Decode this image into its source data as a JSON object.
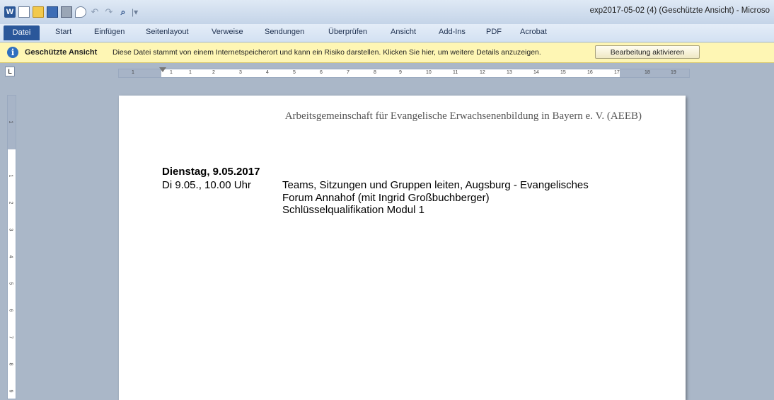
{
  "title_bar": {
    "title": "exp2017-05-02 (4) (Geschützte Ansicht) - Microso",
    "app_icon_letter": "W",
    "icons": [
      "word-icon",
      "new-document-icon",
      "open-folder-icon",
      "save-icon",
      "print-icon",
      "print-preview-icon",
      "undo-icon",
      "redo-icon",
      "find-icon"
    ]
  },
  "ribbon": {
    "tabs": [
      "Datei",
      "Start",
      "Einfügen",
      "Seitenlayout",
      "Verweise",
      "Sendungen",
      "Überprüfen",
      "Ansicht",
      "Add-Ins",
      "PDF",
      "Acrobat"
    ]
  },
  "message_bar": {
    "title": "Geschützte Ansicht",
    "text": "Diese Datei stammt von einem Internetspeicherort und kann ein Risiko darstellen. Klicken Sie hier, um weitere Details anzuzeigen.",
    "button": "Bearbeitung aktivieren"
  },
  "ruler": {
    "tab_selector": "L",
    "horizontal_labels": [
      "1",
      "1",
      "1",
      "2",
      "3",
      "4",
      "5",
      "6",
      "7",
      "8",
      "9",
      "10",
      "11",
      "12",
      "13",
      "14",
      "15",
      "16",
      "17",
      "18",
      "19"
    ],
    "vertical_labels": [
      "1",
      "1",
      "2",
      "3",
      "4",
      "5",
      "6",
      "7",
      "8",
      "9"
    ]
  },
  "document": {
    "header": "Arbeitsgemeinschaft für Evangelische Erwachsenenbildung in Bayern e. V. (AEEB)",
    "heading": "Dienstag, 9.05.2017",
    "time": "Di 9.05., 10.00 Uhr",
    "description_lines": [
      "Teams, Sitzungen und Gruppen leiten, Augsburg - Evangelisches",
      "Forum Annahof (mit Ingrid Großbuchberger)",
      "Schlüsselqualifikation Modul 1"
    ]
  },
  "colors": {
    "file_tab": "#2a579a",
    "message_bar": "#fef6b4",
    "workspace": "#aab7c8"
  }
}
